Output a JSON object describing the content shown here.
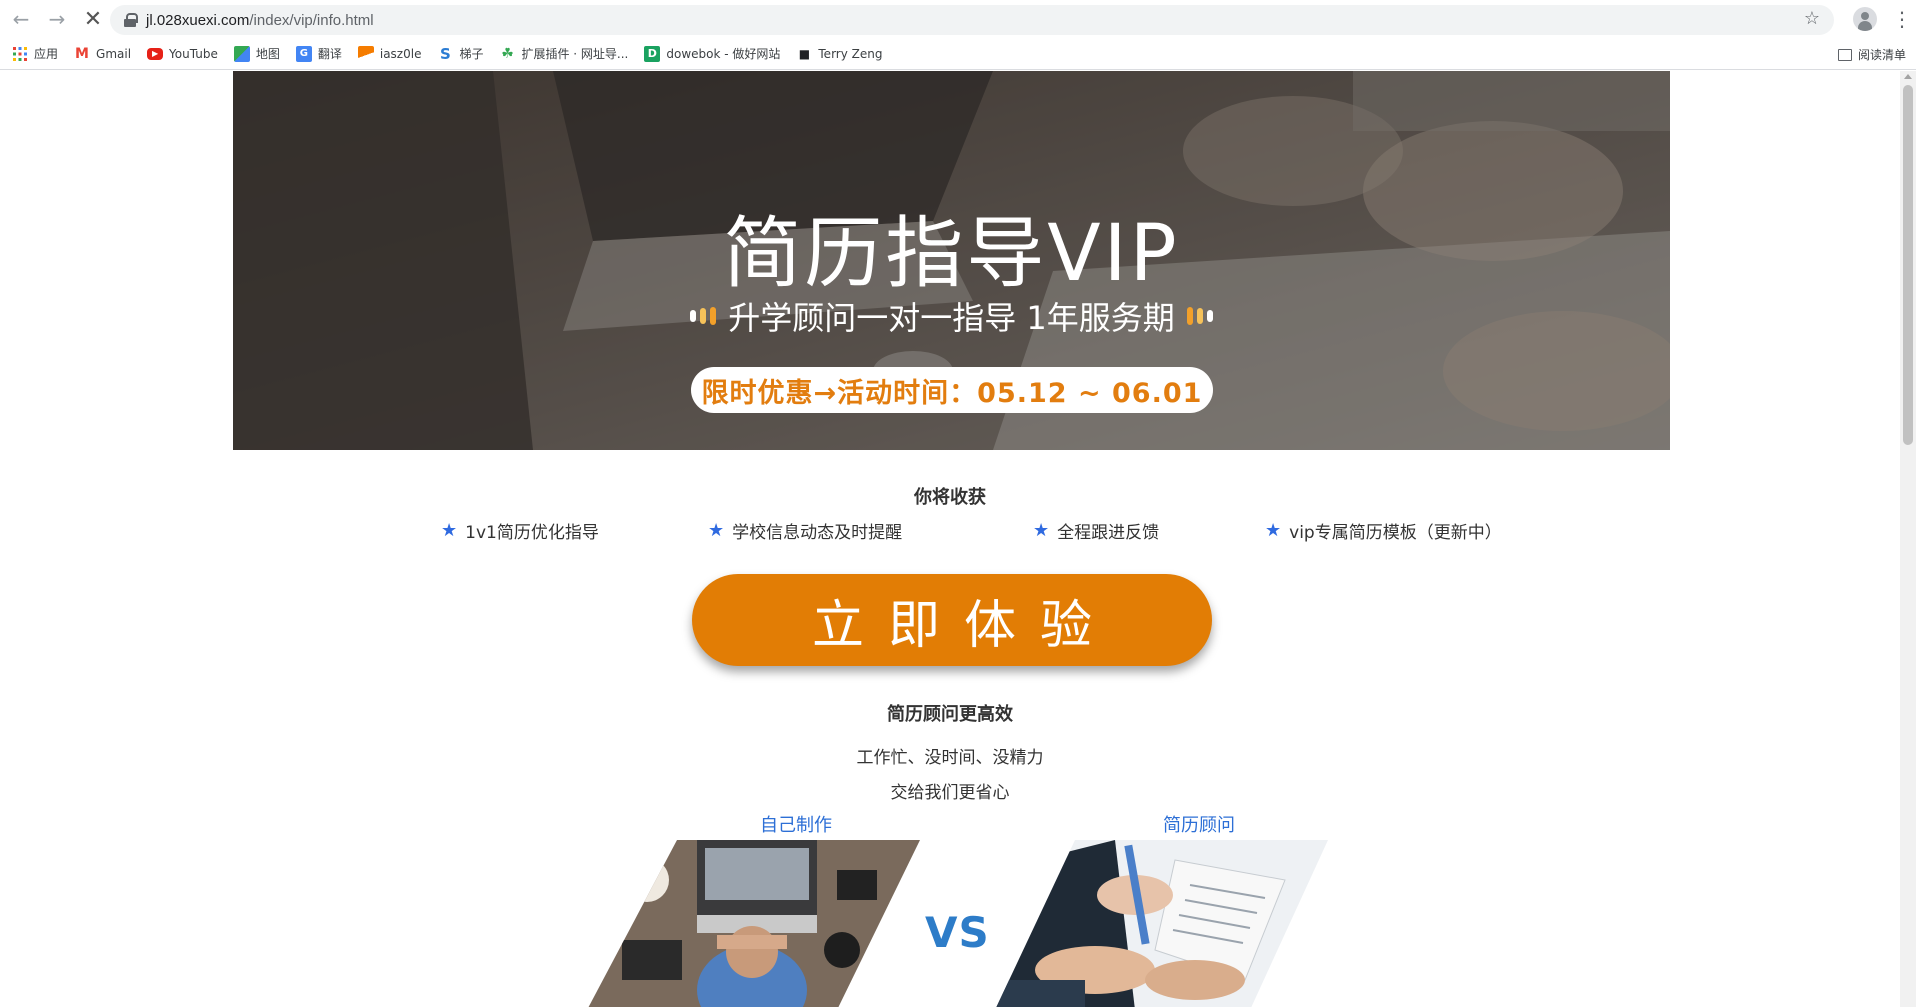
{
  "browser": {
    "url_domain": "jl.028xuexi.com",
    "url_path": "/index/vip/info.html",
    "bookmarks": [
      {
        "label": "应用",
        "icon": "apps-grid-icon"
      },
      {
        "label": "Gmail",
        "icon": "gmail-icon"
      },
      {
        "label": "YouTube",
        "icon": "youtube-icon"
      },
      {
        "label": "地图",
        "icon": "maps-icon"
      },
      {
        "label": "翻译",
        "icon": "translate-icon"
      },
      {
        "label": "iasz0le",
        "icon": "bookmark-flag-icon"
      },
      {
        "label": "梯子",
        "icon": "s-logo-icon"
      },
      {
        "label": "扩展插件 · 网址导...",
        "icon": "extension-icon"
      },
      {
        "label": "dowebok - 做好网站",
        "icon": "d-logo-icon"
      },
      {
        "label": "Terry Zeng",
        "icon": "terry-icon"
      }
    ],
    "reading_list": "阅读清单"
  },
  "banner": {
    "title": "简历指导VIP",
    "subtitle": "升学顾问一对一指导 1年服务期",
    "promo": "限时优惠→活动时间：05.12 ~ 06.01"
  },
  "benefits": {
    "heading": "你将收获",
    "items": [
      "1v1简历优化指导",
      "学校信息动态及时提醒",
      "全程跟进反馈",
      "vip专属简历模板（更新中）"
    ]
  },
  "cta": {
    "label": "立即体验"
  },
  "efficiency": {
    "heading": "简历顾问更高效",
    "line1": "工作忙、没时间、没精力",
    "line2": "交给我们更省心",
    "left_label": "自己制作",
    "right_label": "简历顾问",
    "vs": "VS"
  },
  "colors": {
    "accent_orange": "#e27d05",
    "star_blue": "#2f6ae0",
    "link_blue": "#2d6fd6"
  }
}
